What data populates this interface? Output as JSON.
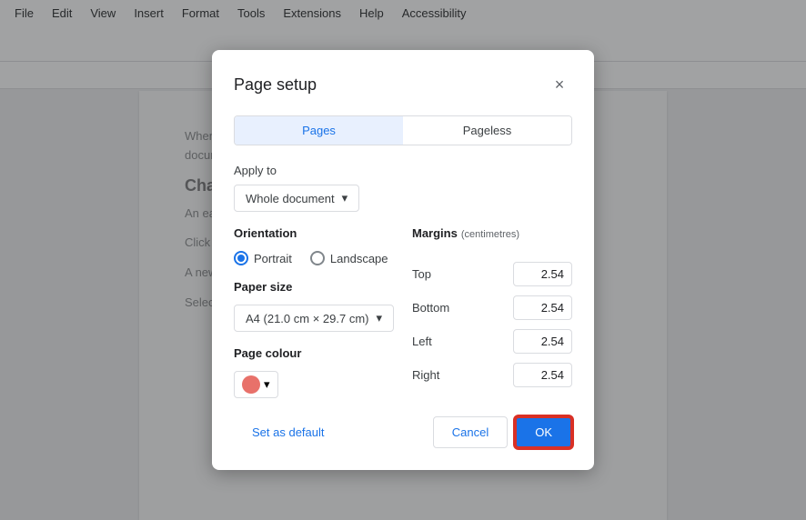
{
  "menubar": {
    "items": [
      "File",
      "Edit",
      "View",
      "Insert",
      "Format",
      "Tools",
      "Extensions",
      "Help",
      "Accessibility"
    ]
  },
  "dialog": {
    "title": "Page setup",
    "close_icon": "×",
    "tabs": [
      {
        "id": "pages",
        "label": "Pages",
        "active": true
      },
      {
        "id": "pageless",
        "label": "Pageless",
        "active": false
      }
    ],
    "apply_to": {
      "label": "Apply to",
      "value": "Whole document",
      "dropdown_icon": "▾"
    },
    "orientation": {
      "title": "Orientation",
      "options": [
        {
          "id": "portrait",
          "label": "Portrait",
          "selected": true
        },
        {
          "id": "landscape",
          "label": "Landscape",
          "selected": false
        }
      ]
    },
    "paper_size": {
      "title": "Paper size",
      "value": "A4 (21.0 cm × 29.7 cm)",
      "dropdown_icon": "▾"
    },
    "page_colour": {
      "title": "Page colour",
      "color": "#e8716a"
    },
    "margins": {
      "title": "Margins",
      "subtitle": "(centimetres)",
      "fields": [
        {
          "id": "top",
          "label": "Top",
          "value": "2.54"
        },
        {
          "id": "bottom",
          "label": "Bottom",
          "value": "2.54"
        },
        {
          "id": "left",
          "label": "Left",
          "value": "2.54"
        },
        {
          "id": "right",
          "label": "Right",
          "value": "2.54"
        }
      ]
    },
    "footer": {
      "set_default_label": "Set as default",
      "cancel_label": "Cancel",
      "ok_label": "OK"
    }
  },
  "doc": {
    "heading": "Change Backg",
    "paragraphs": [
      "When writing on Go... the cause of increa... Docs allows you to c... your document look m... likely to increase.",
      "An easy way to chan... color. Doing so will a... Here's how to do it:",
      "Click on the File tab ...",
      "A new dialog box will ...",
      "Select a color to set as your background..."
    ]
  }
}
